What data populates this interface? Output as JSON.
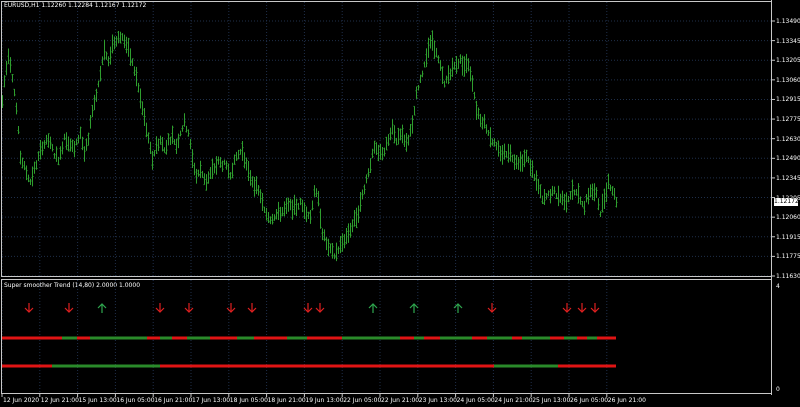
{
  "symbol_header": "EURUSD,H1  1.12260 1.12284 1.12167 1.12172",
  "indicator_header": "Super smoother Trend (14,80) 2.0000 1.0000",
  "colors": {
    "background": "#000000",
    "grid": "#1f2f4a",
    "frame": "#c8c8c8",
    "candle": "#2e9e2e",
    "up_arrow": "#2fa84f",
    "down_arrow": "#e02020",
    "trend_up": "#2a8a2a",
    "trend_down": "#e01414",
    "price_tag_bg": "#ffffff",
    "price_tag_text": "#000000"
  },
  "price_axis": {
    "labels": [
      "1.13490",
      "1.13345",
      "1.13205",
      "1.13060",
      "1.12915",
      "1.12775",
      "1.12630",
      "1.12490",
      "1.12345",
      "1.12205",
      "1.12060",
      "1.11915",
      "1.11775",
      "1.11630"
    ],
    "current_price": "1.12172"
  },
  "indicator_axis": {
    "labels": [
      "4",
      "0"
    ]
  },
  "time_axis": {
    "labels": [
      "12 Jun 2020",
      "12 Jun 21:00",
      "15 Jun 13:00",
      "16 Jun 05:00",
      "16 Jun 21:00",
      "17 Jun 13:00",
      "18 Jun 05:00",
      "18 Jun 21:00",
      "19 Jun 13:00",
      "22 Jun 05:00",
      "22 Jun 21:00",
      "23 Jun 13:00",
      "24 Jun 05:00",
      "24 Jun 21:00",
      "25 Jun 13:00",
      "26 Jun 05:00",
      "26 Jun 21:00"
    ]
  },
  "chart_data": {
    "type": "bar",
    "symbol": "EURUSD",
    "timeframe": "H1",
    "ylim": [
      1.1163,
      1.1349
    ],
    "price_path": [
      [
        0,
        1.129
      ],
      [
        2,
        1.1305
      ],
      [
        6,
        1.1325
      ],
      [
        9,
        1.1315
      ],
      [
        14,
        1.1285
      ],
      [
        18,
        1.125
      ],
      [
        22,
        1.1242
      ],
      [
        28,
        1.1232
      ],
      [
        34,
        1.1245
      ],
      [
        40,
        1.1258
      ],
      [
        46,
        1.1262
      ],
      [
        52,
        1.1252
      ],
      [
        57,
        1.1248
      ],
      [
        62,
        1.1265
      ],
      [
        67,
        1.126
      ],
      [
        72,
        1.1255
      ],
      [
        78,
        1.1268
      ],
      [
        82,
        1.1252
      ],
      [
        86,
        1.1262
      ],
      [
        90,
        1.1285
      ],
      [
        94,
        1.1295
      ],
      [
        98,
        1.1312
      ],
      [
        102,
        1.1328
      ],
      [
        106,
        1.1318
      ],
      [
        110,
        1.1332
      ],
      [
        114,
        1.1336
      ],
      [
        118,
        1.1338
      ],
      [
        122,
        1.1335
      ],
      [
        126,
        1.1328
      ],
      [
        130,
        1.1318
      ],
      [
        134,
        1.1308
      ],
      [
        138,
        1.1292
      ],
      [
        142,
        1.1278
      ],
      [
        146,
        1.1262
      ],
      [
        150,
        1.1248
      ],
      [
        154,
        1.1258
      ],
      [
        158,
        1.1262
      ],
      [
        162,
        1.1255
      ],
      [
        166,
        1.1262
      ],
      [
        170,
        1.1265
      ],
      [
        174,
        1.1258
      ],
      [
        178,
        1.1268
      ],
      [
        182,
        1.1275
      ],
      [
        186,
        1.1268
      ],
      [
        190,
        1.1248
      ],
      [
        194,
        1.1236
      ],
      [
        198,
        1.124
      ],
      [
        204,
        1.1232
      ],
      [
        210,
        1.124
      ],
      [
        216,
        1.1246
      ],
      [
        222,
        1.1244
      ],
      [
        228,
        1.1238
      ],
      [
        234,
        1.125
      ],
      [
        240,
        1.1255
      ],
      [
        246,
        1.1238
      ],
      [
        252,
        1.123
      ],
      [
        258,
        1.1222
      ],
      [
        262,
        1.121
      ],
      [
        268,
        1.1205
      ],
      [
        274,
        1.1208
      ],
      [
        280,
        1.121
      ],
      [
        286,
        1.1214
      ],
      [
        292,
        1.1213
      ],
      [
        298,
        1.1216
      ],
      [
        304,
        1.121
      ],
      [
        308,
        1.1206
      ],
      [
        312,
        1.1226
      ],
      [
        316,
        1.1218
      ],
      [
        320,
        1.1195
      ],
      [
        326,
        1.1183
      ],
      [
        332,
        1.1178
      ],
      [
        338,
        1.1185
      ],
      [
        344,
        1.1192
      ],
      [
        350,
        1.12
      ],
      [
        356,
        1.121
      ],
      [
        362,
        1.1228
      ],
      [
        368,
        1.1245
      ],
      [
        372,
        1.1256
      ],
      [
        376,
        1.1252
      ],
      [
        382,
        1.1254
      ],
      [
        386,
        1.1262
      ],
      [
        390,
        1.127
      ],
      [
        394,
        1.1262
      ],
      [
        398,
        1.1268
      ],
      [
        404,
        1.126
      ],
      [
        410,
        1.1272
      ],
      [
        414,
        1.1295
      ],
      [
        418,
        1.1305
      ],
      [
        422,
        1.1318
      ],
      [
        426,
        1.133
      ],
      [
        430,
        1.1335
      ],
      [
        434,
        1.1325
      ],
      [
        438,
        1.1315
      ],
      [
        442,
        1.1302
      ],
      [
        446,
        1.131
      ],
      [
        450,
        1.1314
      ],
      [
        454,
        1.1318
      ],
      [
        458,
        1.132
      ],
      [
        462,
        1.1316
      ],
      [
        466,
        1.1318
      ],
      [
        470,
        1.1305
      ],
      [
        474,
        1.1285
      ],
      [
        478,
        1.1278
      ],
      [
        482,
        1.1275
      ],
      [
        486,
        1.1268
      ],
      [
        490,
        1.1262
      ],
      [
        494,
        1.1256
      ],
      [
        500,
        1.1252
      ],
      [
        506,
        1.1254
      ],
      [
        512,
        1.1248
      ],
      [
        518,
        1.1246
      ],
      [
        524,
        1.125
      ],
      [
        530,
        1.124
      ],
      [
        536,
        1.1228
      ],
      [
        540,
        1.1218
      ],
      [
        546,
        1.1222
      ],
      [
        552,
        1.1224
      ],
      [
        558,
        1.122
      ],
      [
        564,
        1.1218
      ],
      [
        570,
        1.1225
      ],
      [
        576,
        1.1222
      ],
      [
        582,
        1.1214
      ],
      [
        588,
        1.1226
      ],
      [
        594,
        1.1222
      ],
      [
        598,
        1.121
      ],
      [
        602,
        1.122
      ],
      [
        606,
        1.1232
      ],
      [
        610,
        1.1226
      ],
      [
        614,
        1.1218
      ]
    ],
    "signals": [
      {
        "x": 27,
        "dir": "down"
      },
      {
        "x": 67,
        "dir": "down"
      },
      {
        "x": 100,
        "dir": "up"
      },
      {
        "x": 158,
        "dir": "down"
      },
      {
        "x": 187,
        "dir": "down"
      },
      {
        "x": 229,
        "dir": "down"
      },
      {
        "x": 250,
        "dir": "down"
      },
      {
        "x": 306,
        "dir": "down"
      },
      {
        "x": 318,
        "dir": "down"
      },
      {
        "x": 371,
        "dir": "up"
      },
      {
        "x": 412,
        "dir": "up"
      },
      {
        "x": 456,
        "dir": "up"
      },
      {
        "x": 490,
        "dir": "down"
      },
      {
        "x": 565,
        "dir": "down"
      },
      {
        "x": 580,
        "dir": "down"
      },
      {
        "x": 593,
        "dir": "down"
      }
    ],
    "trend_line_1": [
      [
        "down",
        0,
        60
      ],
      [
        "up",
        60,
        75
      ],
      [
        "down",
        75,
        88
      ],
      [
        "up",
        88,
        145
      ],
      [
        "down",
        145,
        158
      ],
      [
        "up",
        158,
        170
      ],
      [
        "down",
        170,
        185
      ],
      [
        "up",
        185,
        208
      ],
      [
        "down",
        208,
        235
      ],
      [
        "up",
        235,
        252
      ],
      [
        "down",
        252,
        285
      ],
      [
        "up",
        285,
        305
      ],
      [
        "down",
        305,
        340
      ],
      [
        "up",
        340,
        398
      ],
      [
        "down",
        398,
        412
      ],
      [
        "up",
        412,
        422
      ],
      [
        "down",
        422,
        438
      ],
      [
        "up",
        438,
        470
      ],
      [
        "down",
        470,
        485
      ],
      [
        "up",
        485,
        510
      ],
      [
        "down",
        510,
        520
      ],
      [
        "up",
        520,
        548
      ],
      [
        "down",
        548,
        562
      ],
      [
        "up",
        562,
        575
      ],
      [
        "down",
        575,
        585
      ],
      [
        "up",
        585,
        595
      ],
      [
        "down",
        595,
        614
      ]
    ],
    "trend_line_2": [
      [
        "down",
        0,
        50
      ],
      [
        "up",
        50,
        158
      ],
      [
        "down",
        158,
        492
      ],
      [
        "up",
        492,
        556
      ],
      [
        "down",
        556,
        614
      ]
    ]
  }
}
